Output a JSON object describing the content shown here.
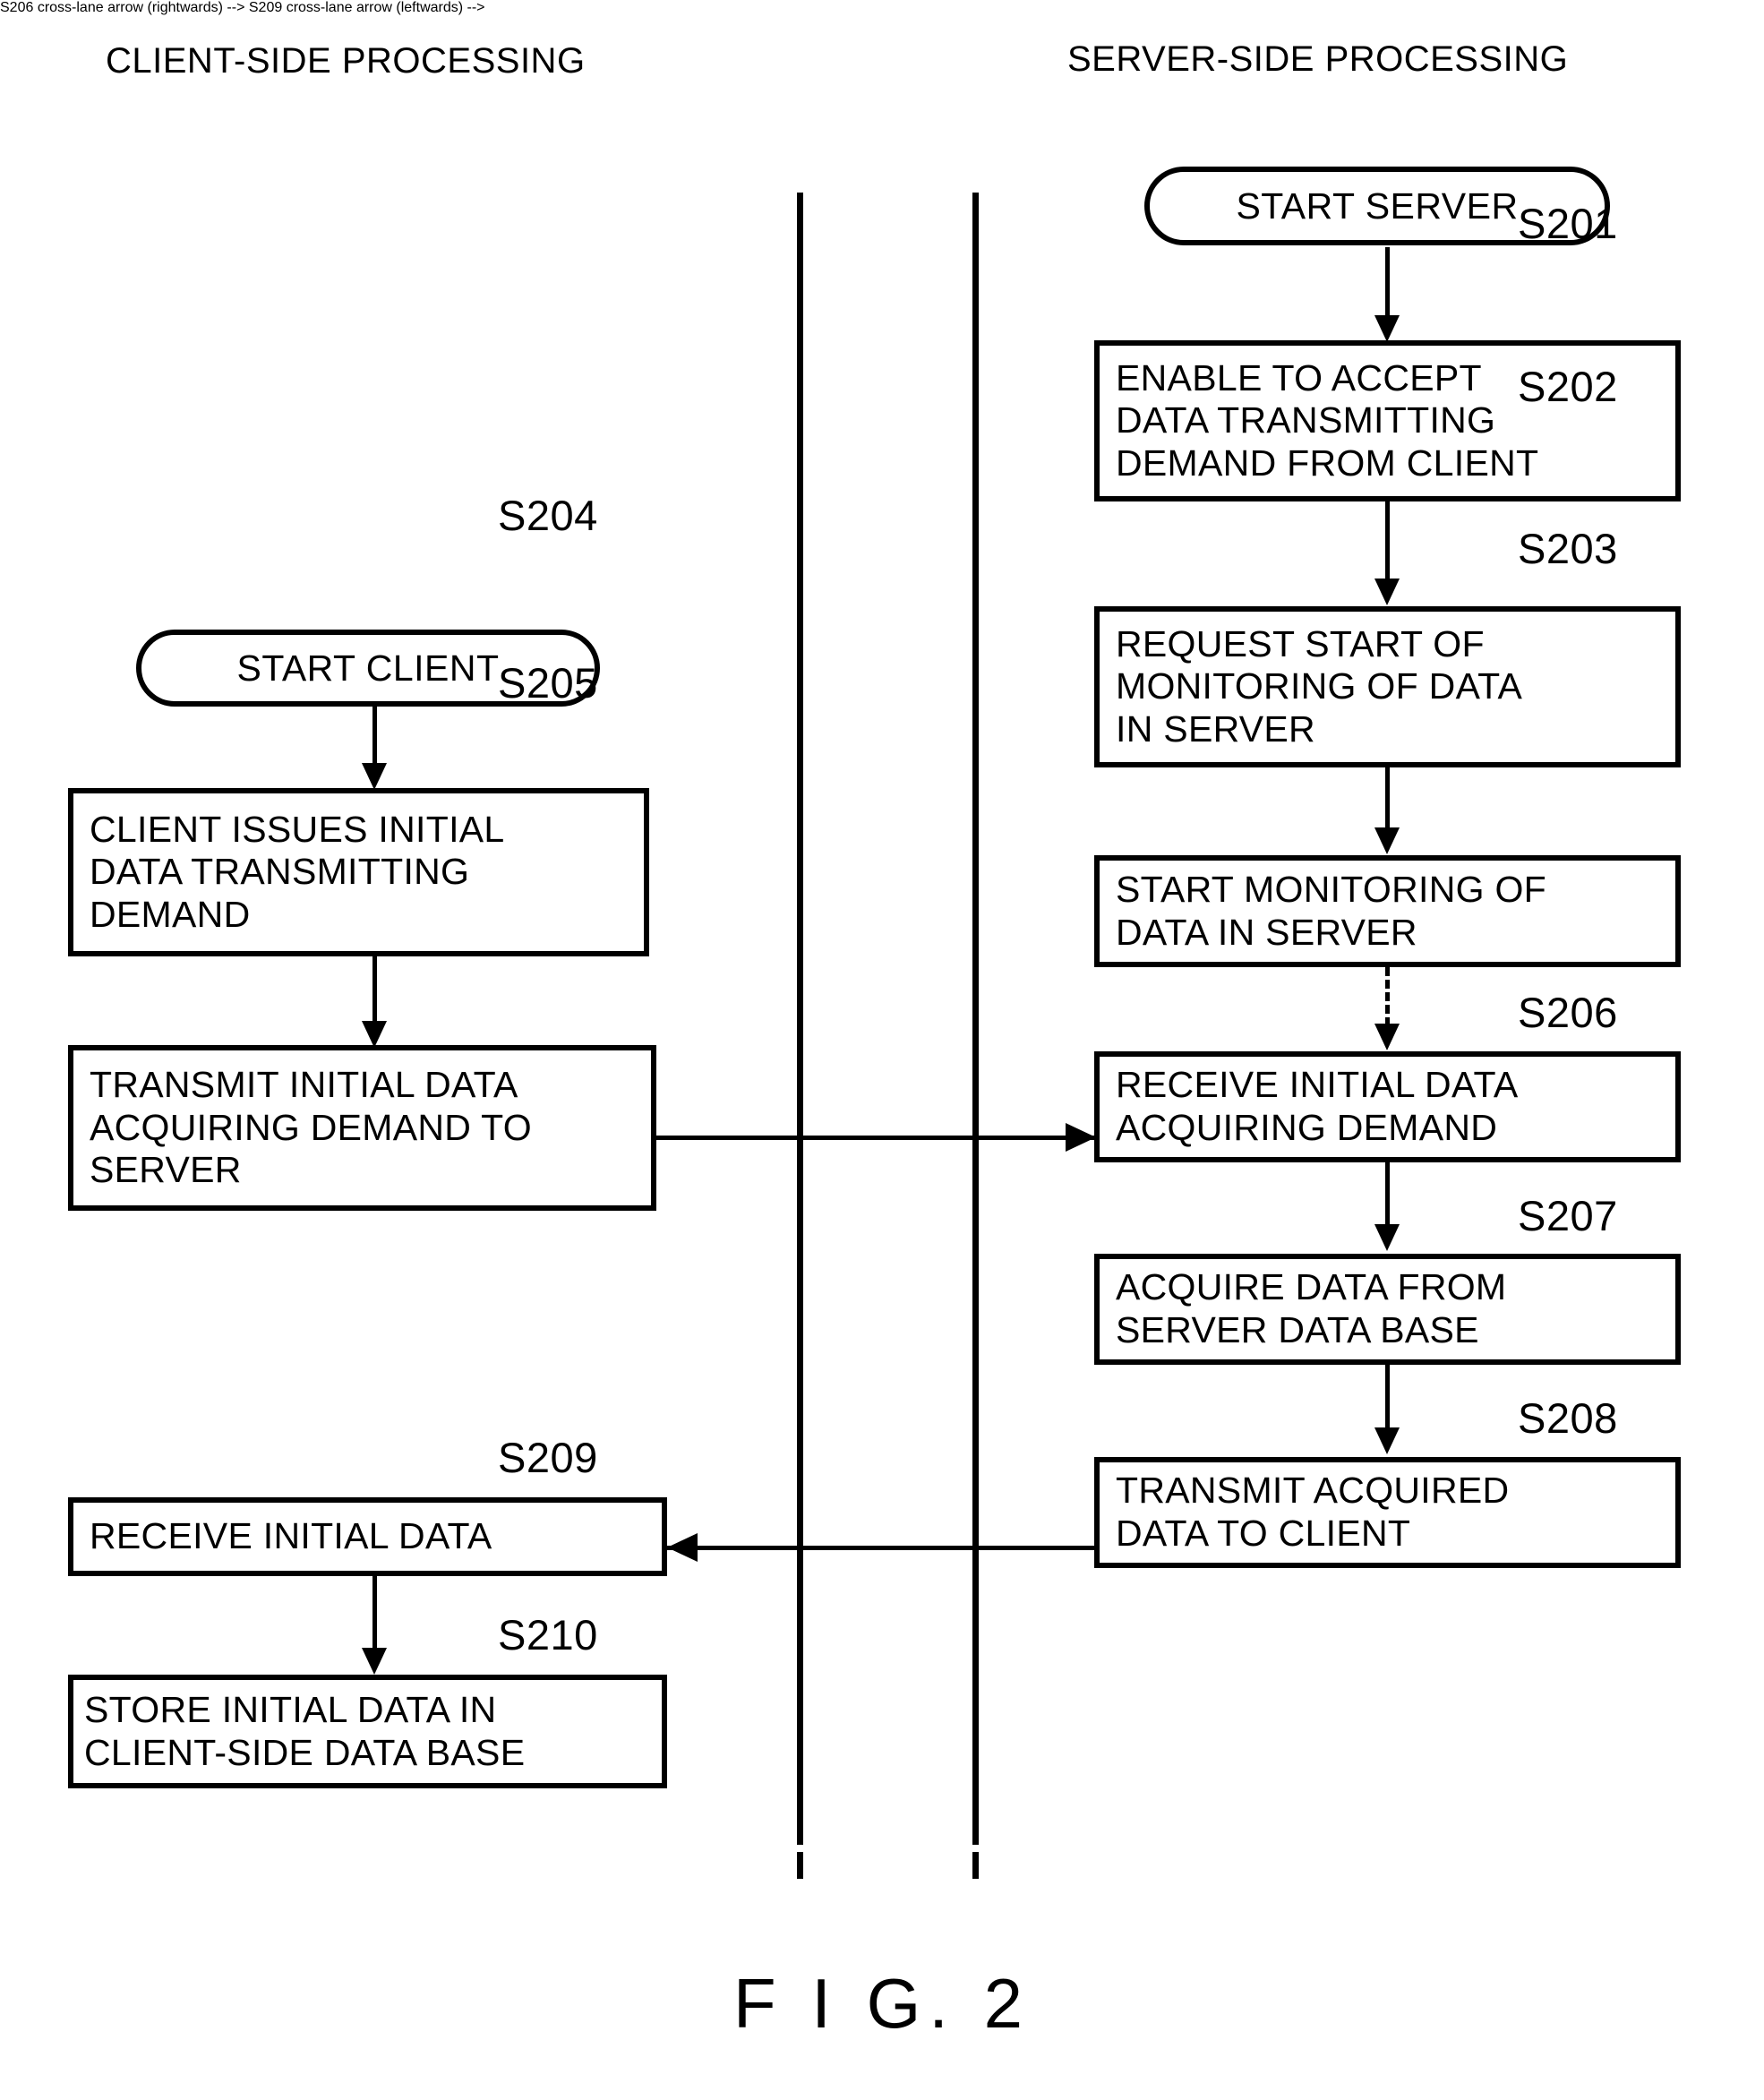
{
  "figure": {
    "caption": "F I G.  2"
  },
  "columns": {
    "client_header": "CLIENT-SIDE PROCESSING",
    "server_header": "SERVER-SIDE PROCESSING"
  },
  "terminals": {
    "start_server": "START SERVER",
    "start_client": "START CLIENT"
  },
  "steps": {
    "s201": {
      "label": "S201",
      "lines": [
        "ENABLE TO ACCEPT",
        "DATA TRANSMITTING",
        "DEMAND FROM CLIENT"
      ]
    },
    "s202": {
      "label": "S202",
      "lines": [
        "REQUEST START OF",
        "MONITORING OF DATA",
        "IN SERVER"
      ]
    },
    "s203": {
      "label": "S203",
      "lines": [
        "START MONITORING OF",
        "DATA IN SERVER"
      ]
    },
    "s204": {
      "label": "S204",
      "lines": [
        "CLIENT ISSUES INITIAL",
        "DATA TRANSMITTING",
        "DEMAND"
      ]
    },
    "s205": {
      "label": "S205",
      "lines": [
        "TRANSMIT INITIAL DATA",
        "ACQUIRING DEMAND TO",
        "SERVER"
      ]
    },
    "s206": {
      "label": "S206",
      "lines": [
        "RECEIVE INITIAL DATA",
        "ACQUIRING DEMAND"
      ]
    },
    "s207": {
      "label": "S207",
      "lines": [
        "ACQUIRE DATA FROM",
        "SERVER DATA BASE"
      ]
    },
    "s208": {
      "label": "S208",
      "lines": [
        "TRANSMIT ACQUIRED",
        "DATA TO CLIENT"
      ]
    },
    "s209": {
      "label": "S209",
      "lines": [
        "RECEIVE INITIAL DATA"
      ]
    },
    "s210": {
      "label": "S210",
      "lines": [
        "STORE INITIAL DATA IN",
        "CLIENT-SIDE DATA BASE"
      ]
    }
  },
  "connectors": {
    "s205_to_s206": "cross-lane arrow right",
    "s208_to_s209": "cross-lane arrow left",
    "s203_to_s206": "dashed arrow down"
  },
  "colors": {
    "stroke": "#000000",
    "background": "#ffffff"
  }
}
